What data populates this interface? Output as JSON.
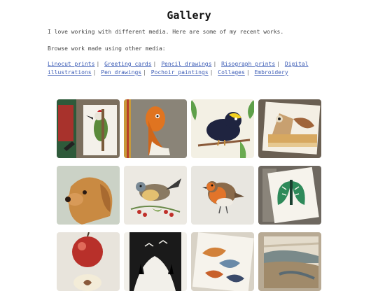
{
  "page": {
    "title": "Gallery",
    "intro": "I love working with different media. Here are some of my recent works.",
    "browse_label": "Browse work made using other media:"
  },
  "media_links": [
    "Linocut prints",
    "Greeting cards",
    "Pencil drawings",
    "Risograph prints",
    "Digital illustrations",
    "Pen drawings",
    "Pochoir paintings",
    "Collages",
    "Embroidery"
  ],
  "separator": "|",
  "colors": {
    "link": "#3b5bb5",
    "text": "#444444",
    "background": "#ffffff"
  }
}
